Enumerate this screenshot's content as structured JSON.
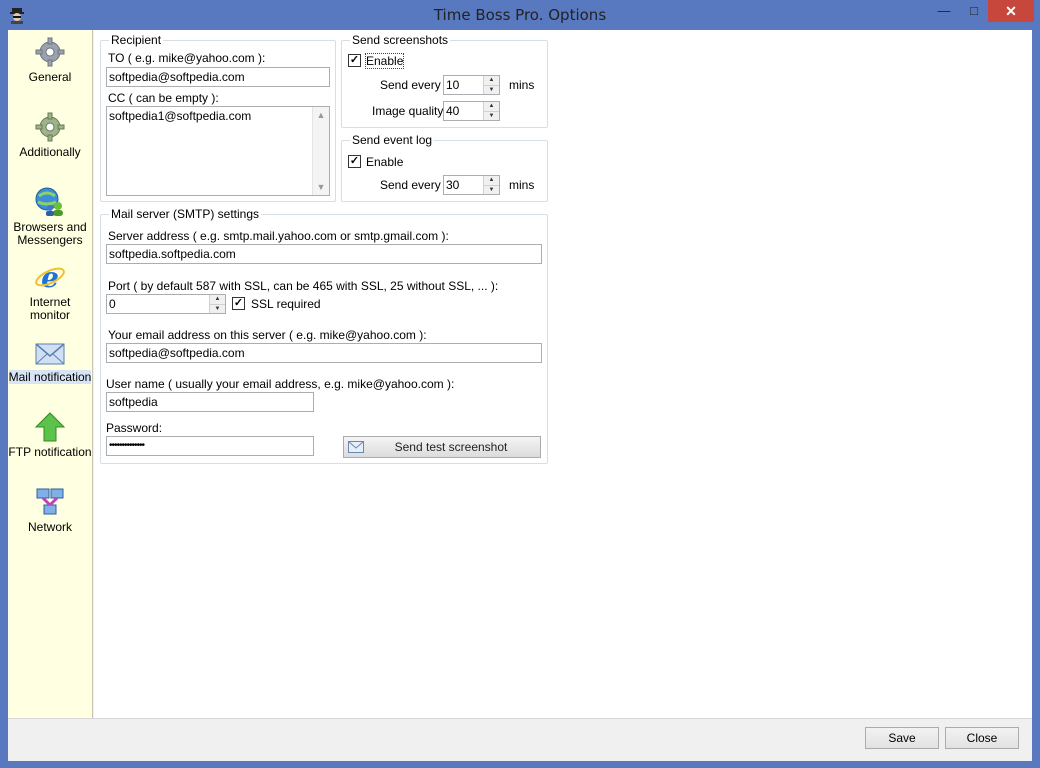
{
  "window": {
    "title": "Time Boss Pro. Options",
    "minimize": "—",
    "maximize": "□",
    "close": "✕"
  },
  "sidebar": {
    "items": [
      {
        "label": "General",
        "icon": "gear-icon"
      },
      {
        "label": "Additionally",
        "icon": "gear-green-icon"
      },
      {
        "label": "Browsers and Messengers",
        "icon": "globe-users-icon"
      },
      {
        "label": "Internet monitor",
        "icon": "ie-icon"
      },
      {
        "label": "Mail notification",
        "icon": "envelope-icon"
      },
      {
        "label": "FTP notification",
        "icon": "up-arrow-icon"
      },
      {
        "label": "Network",
        "icon": "network-icon"
      }
    ],
    "selected": "Mail notification"
  },
  "recipient": {
    "group_title": "Recipient",
    "to_label": "TO ( e.g. mike@yahoo.com ):",
    "to_value": "softpedia@softpedia.com",
    "cc_label": "CC ( can be empty ):",
    "cc_value": "softpedia1@softpedia.com"
  },
  "screenshots": {
    "group_title": "Send screenshots",
    "enable_label": "Enable",
    "enabled": true,
    "send_every_label": "Send every",
    "send_every_value": "10",
    "mins_label": "mins",
    "quality_label": "Image quality",
    "quality_value": "40"
  },
  "event_log": {
    "group_title": "Send event log",
    "enable_label": "Enable",
    "enabled": true,
    "send_every_label": "Send every",
    "send_every_value": "30",
    "mins_label": "mins"
  },
  "smtp": {
    "group_title": "Mail server (SMTP) settings",
    "server_label": "Server address   ( e.g. smtp.mail.yahoo.com or smtp.gmail.com ):",
    "server_value": "softpedia.softpedia.com",
    "port_label": "Port   ( by default 587 with SSL, can be 465 with SSL, 25 without SSL, ... ):",
    "port_value": "0",
    "ssl_label": "SSL required",
    "ssl_checked": true,
    "email_label": "Your email address on this server ( e.g. mike@yahoo.com ):",
    "email_value": "softpedia@softpedia.com",
    "username_label": "User name  ( usually your email address, e.g. mike@yahoo.com ):",
    "username_value": "softpedia",
    "password_label": "Password:",
    "password_value": "••••••••••••••",
    "test_button": "Send test screenshot"
  },
  "footer": {
    "save": "Save",
    "close": "Close"
  },
  "colors": {
    "titlebar": "#5879c0",
    "close_button": "#c7473c",
    "sidebar_bg": "#ffffe1"
  }
}
